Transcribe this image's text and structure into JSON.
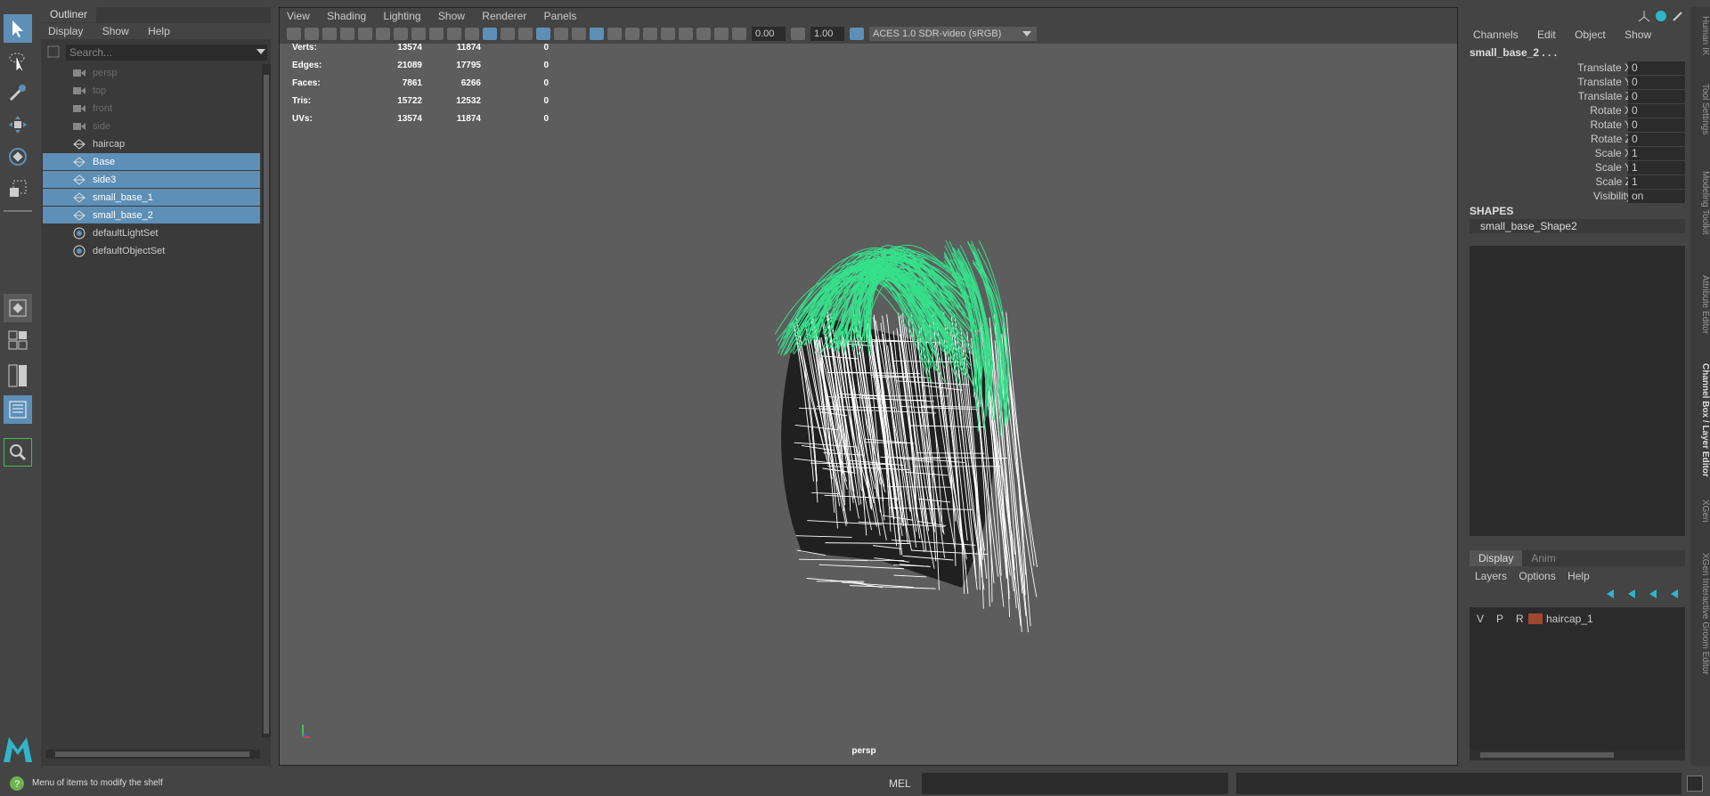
{
  "outliner": {
    "tab": "Outliner",
    "menu": [
      "Display",
      "Show",
      "Help"
    ],
    "search_placeholder": "Search...",
    "items": [
      {
        "label": "persp",
        "icon": "camera-icon",
        "dim": true
      },
      {
        "label": "top",
        "icon": "camera-icon",
        "dim": true
      },
      {
        "label": "front",
        "icon": "camera-icon",
        "dim": true
      },
      {
        "label": "side",
        "icon": "camera-icon",
        "dim": true
      },
      {
        "label": "haircap",
        "icon": "mesh-icon"
      },
      {
        "label": "Base",
        "icon": "mesh-icon",
        "selected": true
      },
      {
        "label": "side3",
        "icon": "mesh-icon",
        "selected": true
      },
      {
        "label": "small_base_1",
        "icon": "mesh-icon",
        "selected": true
      },
      {
        "label": "small_base_2",
        "icon": "mesh-icon",
        "selected": true
      },
      {
        "label": "defaultLightSet",
        "icon": "set-icon"
      },
      {
        "label": "defaultObjectSet",
        "icon": "set-icon"
      }
    ]
  },
  "viewport": {
    "menu": [
      "View",
      "Shading",
      "Lighting",
      "Show",
      "Renderer",
      "Panels"
    ],
    "exposure": "0.00",
    "gamma": "1.00",
    "color_space": "ACES 1.0 SDR-video (sRGB)",
    "camera_label": "persp",
    "hud": [
      {
        "label": "Verts:",
        "a": "13574",
        "b": "11874",
        "c": "0"
      },
      {
        "label": "Edges:",
        "a": "21089",
        "b": "17795",
        "c": "0"
      },
      {
        "label": "Faces:",
        "a": "7861",
        "b": "6266",
        "c": "0"
      },
      {
        "label": "Tris:",
        "a": "15722",
        "b": "12532",
        "c": "0"
      },
      {
        "label": "UVs:",
        "a": "13574",
        "b": "11874",
        "c": "0"
      }
    ]
  },
  "channels": {
    "menu": [
      "Channels",
      "Edit",
      "Object",
      "Show"
    ],
    "object_name": "small_base_2 . . .",
    "attrs": [
      {
        "name": "Translate X",
        "value": "0"
      },
      {
        "name": "Translate Y",
        "value": "0"
      },
      {
        "name": "Translate Z",
        "value": "0"
      },
      {
        "name": "Rotate X",
        "value": "0"
      },
      {
        "name": "Rotate Y",
        "value": "0"
      },
      {
        "name": "Rotate Z",
        "value": "0"
      },
      {
        "name": "Scale X",
        "value": "1"
      },
      {
        "name": "Scale Y",
        "value": "1"
      },
      {
        "name": "Scale Z",
        "value": "1"
      },
      {
        "name": "Visibility",
        "value": "on"
      }
    ],
    "shapes_header": "SHAPES",
    "shape_name": "small_base_Shape2"
  },
  "layers": {
    "tabs": [
      "Display",
      "Anim"
    ],
    "menu": [
      "Layers",
      "Options",
      "Help"
    ],
    "row": {
      "v": "V",
      "p": "P",
      "r": "R",
      "name": "haircap_1",
      "color": "#a0482d"
    }
  },
  "side_tabs": [
    "Human IK",
    "Tool Settings",
    "Modeling Toolkit",
    "Attribute Editor",
    "Channel Box / Layer Editor",
    "XGen",
    "XGen Interactive Groom Editor"
  ],
  "status": {
    "help_text": "Menu of items to modify the shelf",
    "mel_label": "MEL"
  },
  "colors": {
    "selection": "#5d8fb7",
    "hair_green": "#36e08a",
    "wire_white": "#ffffff"
  }
}
